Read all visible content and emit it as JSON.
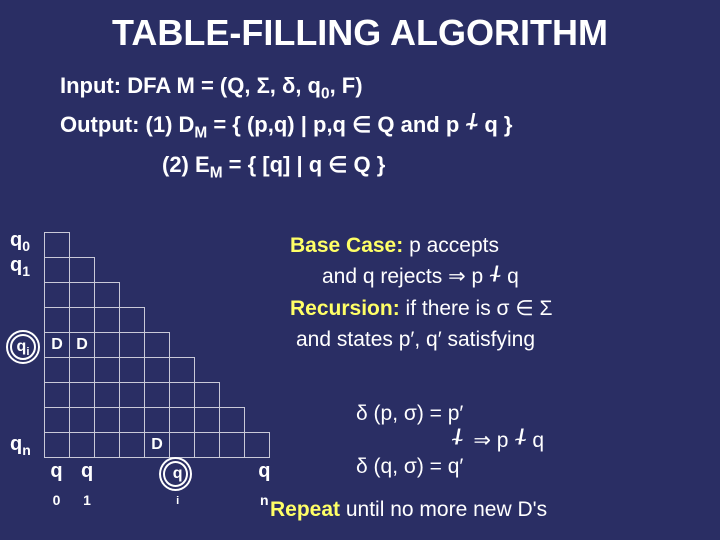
{
  "title_bold": "TABLE-FILLING",
  "title_rest": " ALGORITHM",
  "input_label": "Input:",
  "input_value": " DFA M = (Q, Σ, δ, q",
  "input_sub": "0",
  "input_tail": ", F)",
  "output_label": "Output:",
  "output1_pre": "  (1) D",
  "output1_sub": "M",
  "output1_mid": " = { (p,q) | p,q ∈ Q and p ",
  "output1_rel": "~",
  "output1_tail": " q }",
  "output2_pre": "(2) E",
  "output2_sub": "M",
  "output2_tail": " = { [q] | q ∈ Q }",
  "ylab_q0": "q",
  "ylab_q0_sub": "0",
  "ylab_q1": "q",
  "ylab_q1_sub": "1",
  "ylab_qi": "q",
  "ylab_qi_sub": "i",
  "ylab_qn": "q",
  "ylab_qn_sub": "n",
  "cell_d": "D",
  "xlab_q0": "q",
  "xlab_q0_sub": "0",
  "xlab_q1": "q",
  "xlab_q1_sub": "1",
  "xlab_qi": "q",
  "xlab_qi_sub": "i",
  "xlab_qn": "q",
  "xlab_qn_sub": "n",
  "base_hdr": "Base Case:",
  "base_txt1": " p accepts",
  "base_txt2": "and q rejects ⇒ p ",
  "base_rel": "~",
  "base_txt3": " q",
  "rec_hdr": "Recursion:",
  "rec_txt1": " if there is σ ∈ Σ",
  "rec_txt2": "and states p′, q′ satisfying",
  "delta_l1": "δ (p, σ) =  p′",
  "delta_mid_rel": "~",
  "delta_mid_arrow": "  ⇒  p ",
  "delta_mid_rel2": "~",
  "delta_mid_tail": " q",
  "delta_l3": "δ (q, σ) = q′",
  "repeat_hdr": "Repeat",
  "repeat_txt": " until no more new D's"
}
